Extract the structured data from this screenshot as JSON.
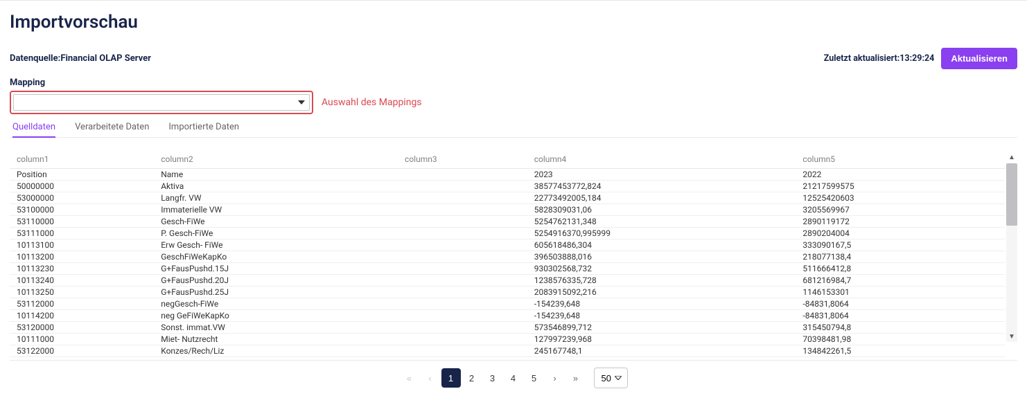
{
  "title": "Importvorschau",
  "datasource_label": "Datenquelle:",
  "datasource_value": "Financial OLAP Server",
  "last_updated_label": "Zuletzt aktualisiert:",
  "last_updated_value": "13:29:24",
  "refresh_label": "Aktualisieren",
  "mapping_label": "Mapping",
  "mapping_selected": "",
  "mapping_annotation": "Auswahl des Mappings",
  "tabs": [
    {
      "label": "Quelldaten",
      "active": true
    },
    {
      "label": "Verarbeitete Daten",
      "active": false
    },
    {
      "label": "Importierte Daten",
      "active": false
    }
  ],
  "columns": [
    "column1",
    "column2",
    "column3",
    "column4",
    "column5"
  ],
  "rows": [
    [
      "Position",
      "Name",
      "",
      "2023",
      "2022"
    ],
    [
      "50000000",
      "Aktiva",
      "",
      "38577453772,824",
      "21217599575"
    ],
    [
      "53000000",
      "Langfr. VW",
      "",
      "22773492005,184",
      "12525420603"
    ],
    [
      "53100000",
      "Immaterielle VW",
      "",
      "5828309031,06",
      "3205569967"
    ],
    [
      "53110000",
      "Gesch-FiWe",
      "",
      "5254762131,348",
      "2890119172"
    ],
    [
      "53111000",
      "P. Gesch-FiWe",
      "",
      "5254916370,995999",
      "2890204004"
    ],
    [
      "10113100",
      "Erw Gesch- FiWe",
      "",
      "605618486,304",
      "333090167,5"
    ],
    [
      "10113200",
      "GeschFiWeKapKo",
      "",
      "396503888,016",
      "218077138,4"
    ],
    [
      "10113230",
      "G+FausPushd.15J",
      "",
      "930302568,732",
      "511666412,8"
    ],
    [
      "10113240",
      "G+FausPushd.20J",
      "",
      "1238576335,728",
      "681216984,7"
    ],
    [
      "10113250",
      "G+FausPushd.25J",
      "",
      "2083915092,216",
      "1146153301"
    ],
    [
      "53112000",
      "negGesch-FiWe",
      "",
      "-154239,648",
      "-84831,8064"
    ],
    [
      "10114200",
      "neg GeFiWeKapKo",
      "",
      "-154239,648",
      "-84831,8064"
    ],
    [
      "53120000",
      "Sonst. immat.VW",
      "",
      "573546899,712",
      "315450794,8"
    ],
    [
      "10111000",
      "Miet- Nutzrecht",
      "",
      "127997239,968",
      "70398481,98"
    ],
    [
      "53122000",
      "Konzes/Rech/Liz",
      "",
      "245167748,1",
      "134842261,5"
    ]
  ],
  "pagination": {
    "pages": [
      1,
      2,
      3,
      4,
      5
    ],
    "current": 1,
    "page_size": "50"
  }
}
